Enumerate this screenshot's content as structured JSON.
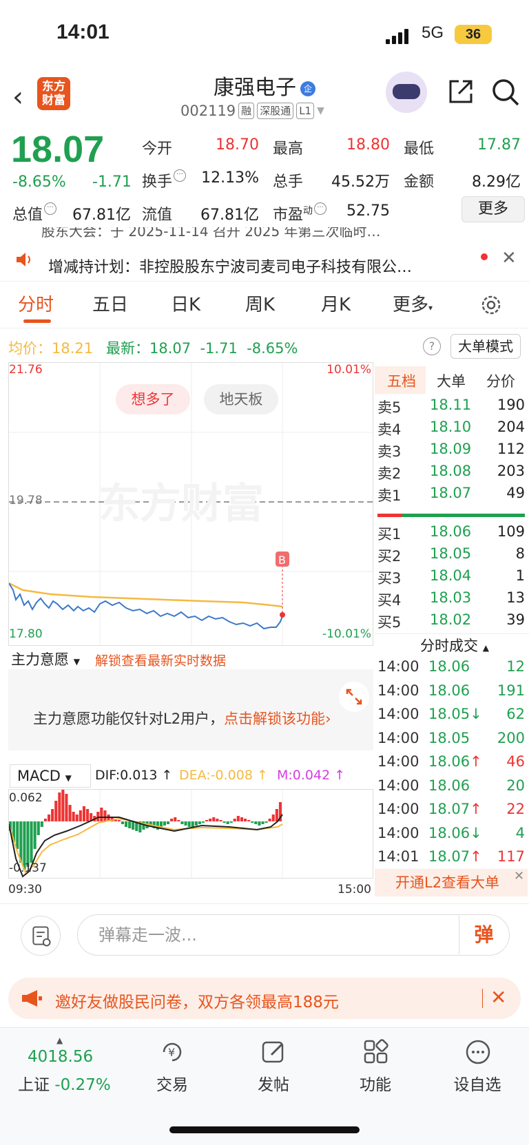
{
  "status": {
    "time": "14:01",
    "network": "5G",
    "battery": "36"
  },
  "header": {
    "logo_line1": "东方",
    "logo_line2": "财富",
    "name": "康强电子",
    "name_badge": "企",
    "code": "002119",
    "tags": [
      "融",
      "深股通",
      "L1"
    ]
  },
  "quote": {
    "price": "18.07",
    "change_pct": "-8.65%",
    "change_abs": "-1.71",
    "open_label": "今开",
    "open": "18.70",
    "high_label": "最高",
    "high": "18.80",
    "low_label": "最低",
    "low": "17.87",
    "turnover_label": "换手",
    "turnover": "12.13%",
    "volume_label": "总手",
    "volume": "45.52万",
    "amount_label": "金额",
    "amount": "8.29亿",
    "mktcap_label": "总值",
    "mktcap": "67.81亿",
    "float_label": "流值",
    "float": "67.81亿",
    "pe_label": "市盈",
    "pe_sup": "动",
    "pe": "52.75",
    "more": "更多"
  },
  "ticker": {
    "text": "股东大会：于 2025-11-14 召开 2025 年第三次临时…"
  },
  "notice": {
    "text": "增减持计划：非控股股东宁波司麦司电子科技有限公…"
  },
  "tabs": [
    "分时",
    "五日",
    "日K",
    "周K",
    "月K",
    "更多"
  ],
  "avg_row": {
    "avg_label": "均价：",
    "avg": "18.21",
    "latest_label": "最新：",
    "latest": "18.07",
    "chg": "-1.71",
    "pct": "-8.65%",
    "help": "?",
    "mode": "大单模式"
  },
  "chart": {
    "y_top": "21.76",
    "y_mid": "19.78",
    "y_bot": "17.80",
    "pct_top": "10.01%",
    "pct_bot": "-10.01%",
    "pill1": "想多了",
    "pill2": "地天板",
    "watermark": "东方财富",
    "marker": "B",
    "colors": {
      "price": "#3a78c9",
      "avg": "#f5b940",
      "up": "#e33",
      "down": "#1fa050"
    }
  },
  "orderbook": {
    "tabs": [
      "五档",
      "大单",
      "分价"
    ],
    "asks": [
      {
        "label": "卖5",
        "price": "18.11",
        "vol": "190"
      },
      {
        "label": "卖4",
        "price": "18.10",
        "vol": "204"
      },
      {
        "label": "卖3",
        "price": "18.09",
        "vol": "112"
      },
      {
        "label": "卖2",
        "price": "18.08",
        "vol": "203"
      },
      {
        "label": "卖1",
        "price": "18.07",
        "vol": "49"
      }
    ],
    "bids": [
      {
        "label": "买1",
        "price": "18.06",
        "vol": "109"
      },
      {
        "label": "买2",
        "price": "18.05",
        "vol": "8"
      },
      {
        "label": "买3",
        "price": "18.04",
        "vol": "1"
      },
      {
        "label": "买4",
        "price": "18.03",
        "vol": "13"
      },
      {
        "label": "买5",
        "price": "18.02",
        "vol": "39"
      }
    ]
  },
  "trades": {
    "title": "分时成交",
    "rows": [
      {
        "time": "14:00",
        "price": "18.06",
        "arrow": "",
        "vol": "12",
        "color": "green"
      },
      {
        "time": "14:00",
        "price": "18.06",
        "arrow": "",
        "vol": "191",
        "color": "green"
      },
      {
        "time": "14:00",
        "price": "18.05",
        "arrow": "↓",
        "vol": "62",
        "color": "green"
      },
      {
        "time": "14:00",
        "price": "18.05",
        "arrow": "",
        "vol": "200",
        "color": "green"
      },
      {
        "time": "14:00",
        "price": "18.06",
        "arrow": "↑",
        "vol": "46",
        "color": "red"
      },
      {
        "time": "14:00",
        "price": "18.06",
        "arrow": "",
        "vol": "20",
        "color": "green"
      },
      {
        "time": "14:00",
        "price": "18.07",
        "arrow": "↑",
        "vol": "22",
        "color": "red"
      },
      {
        "time": "14:00",
        "price": "18.06",
        "arrow": "↓",
        "vol": "4",
        "color": "green"
      },
      {
        "time": "14:01",
        "price": "18.07",
        "arrow": "↑",
        "vol": "117",
        "color": "red"
      }
    ],
    "open_l2": "开通L2查看大单"
  },
  "l2": {
    "dropdown": "主力意愿",
    "unlock_link": "解锁查看最新实时数据",
    "msg": "主力意愿功能仅针对L2用户，",
    "msg_link": "点击解锁该功能"
  },
  "macd": {
    "label": "MACD",
    "dif": "DIF:0.013 ↑",
    "dea": "DEA:-0.008 ↑",
    "m": "M:0.042 ↑",
    "y_top": "0.062",
    "y_bot": "-0.137",
    "t_start": "09:30",
    "t_end": "15:00"
  },
  "danmu": {
    "placeholder": "弹幕走一波...",
    "button": "弹"
  },
  "invite": {
    "text": "邀好友做股民问卷，双方各领最高188元"
  },
  "bottom": {
    "index_value": "4018.56",
    "index_name": "上证",
    "index_change": "-0.27%",
    "items": [
      "交易",
      "发帖",
      "功能",
      "设自选"
    ]
  }
}
